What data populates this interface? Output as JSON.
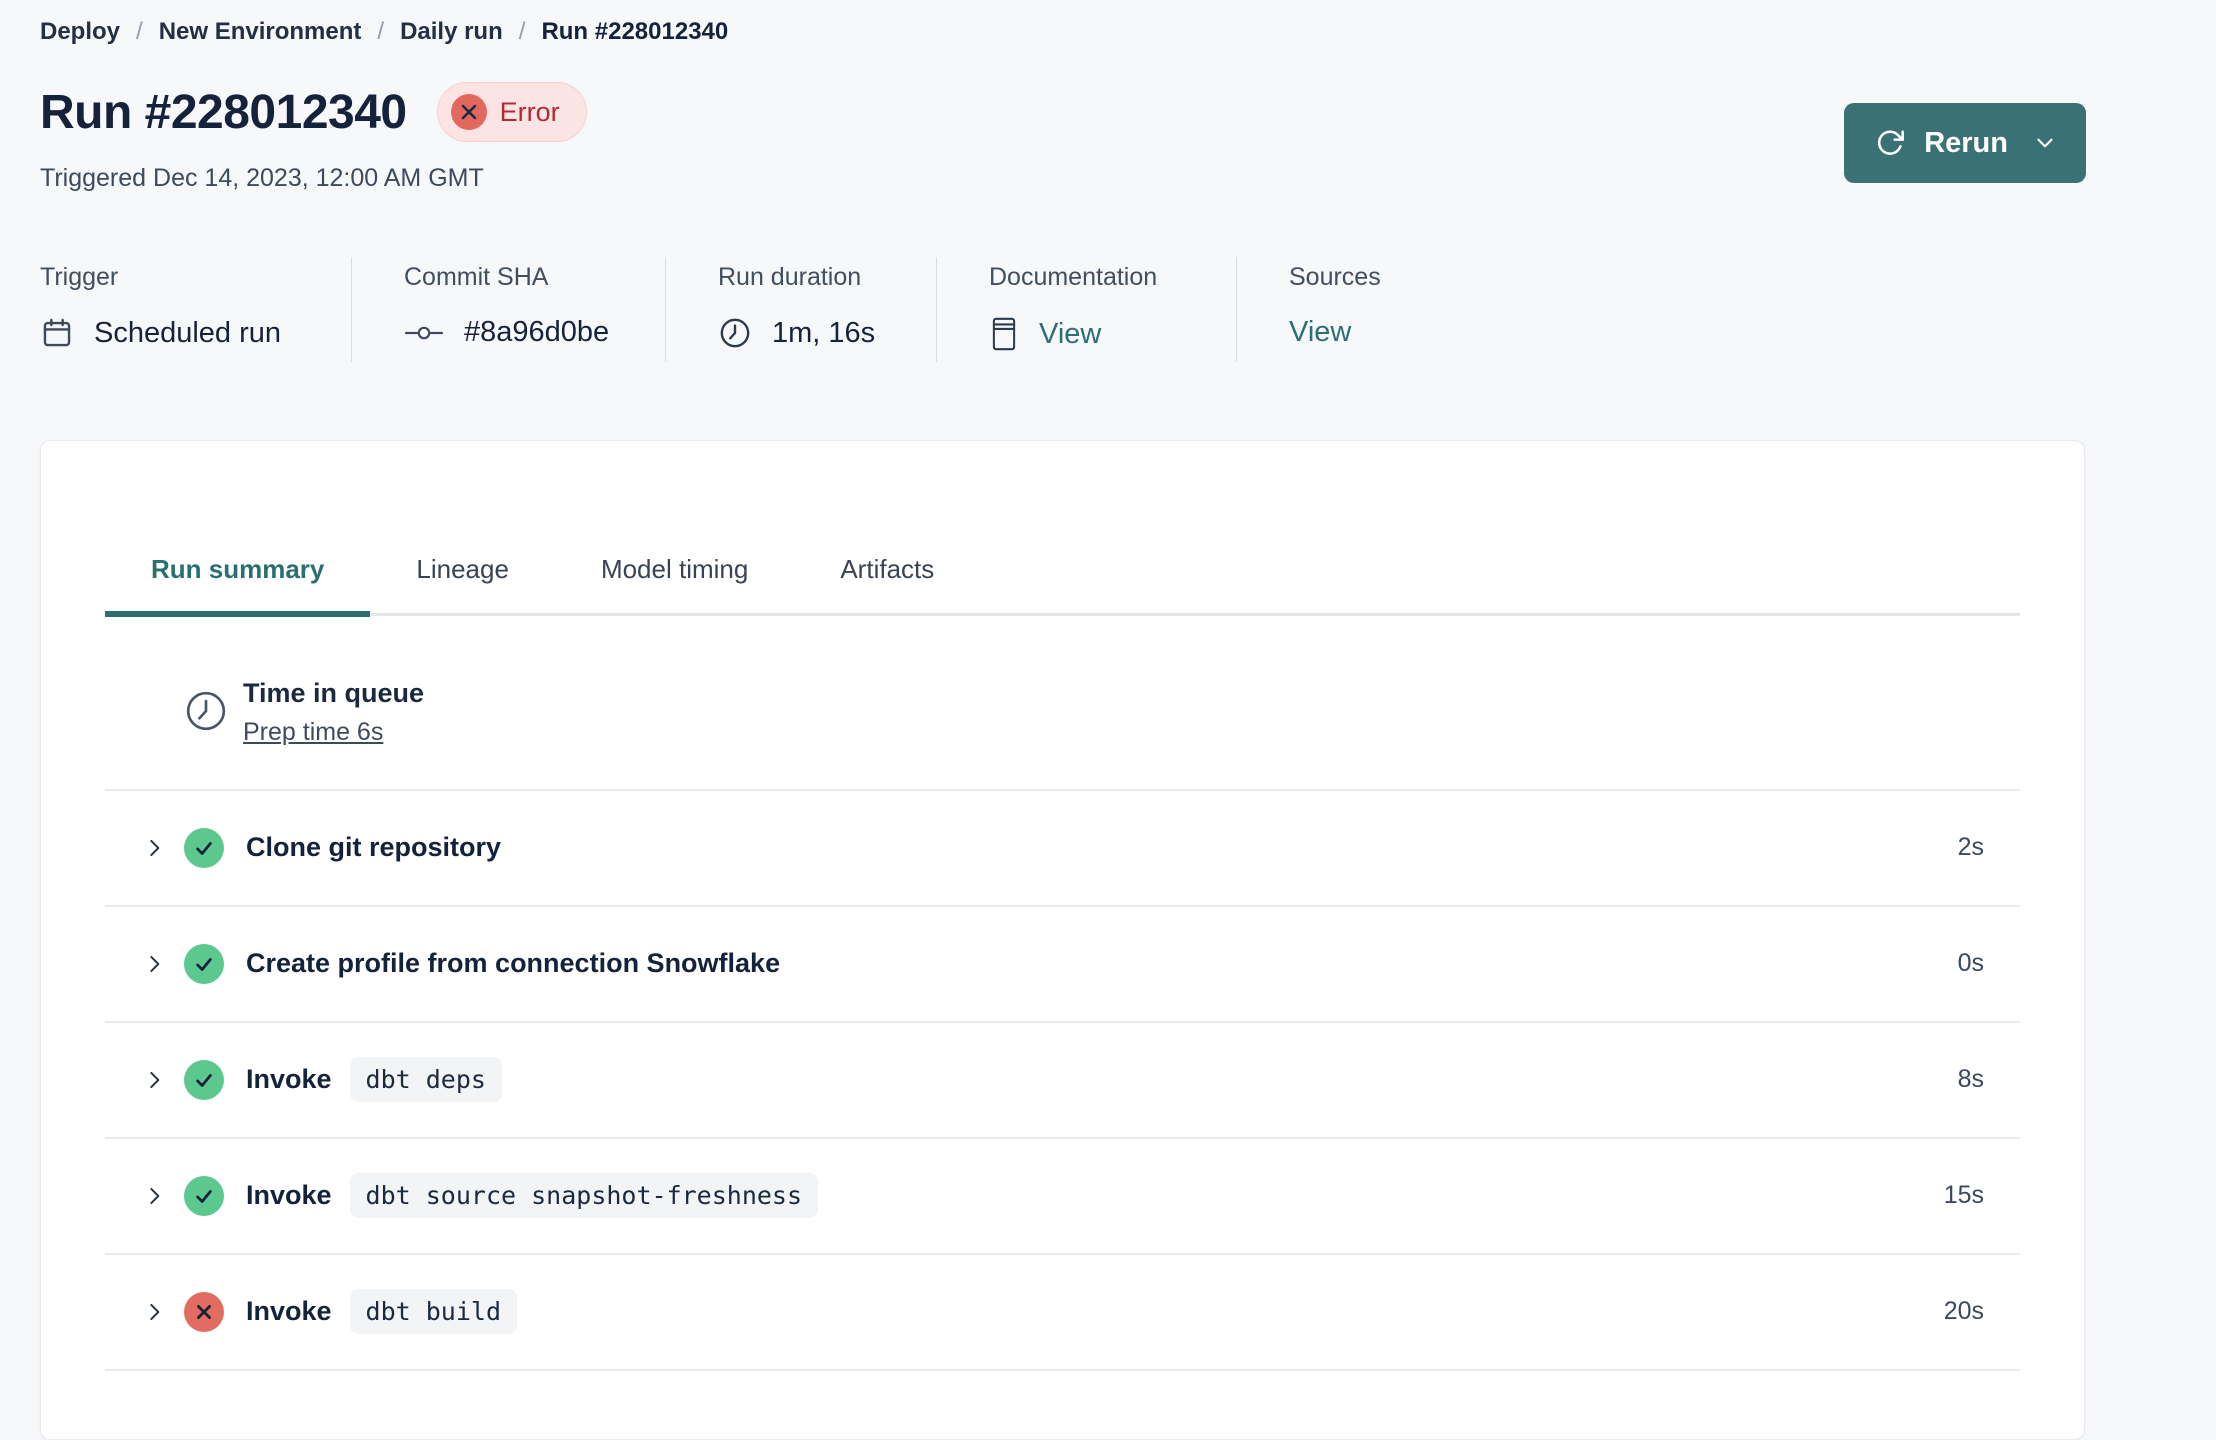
{
  "breadcrumb": {
    "separator": "/",
    "items": [
      "Deploy",
      "New Environment",
      "Daily run",
      "Run #228012340"
    ]
  },
  "header": {
    "title": "Run #228012340",
    "status_badge": {
      "label": "Error",
      "icon": "error-circle-icon"
    },
    "triggered": "Triggered Dec 14, 2023, 12:00 AM GMT",
    "rerun_button": {
      "label": "Rerun",
      "icon": "refresh-icon",
      "chevron_icon": "chevron-down-icon"
    }
  },
  "meta": {
    "columns": [
      {
        "label": "Trigger",
        "value": "Scheduled run",
        "icon": "calendar-icon",
        "link": false
      },
      {
        "label": "Commit SHA",
        "value": "#8a96d0be",
        "icon": "git-commit-icon",
        "link": false
      },
      {
        "label": "Run duration",
        "value": "1m, 16s",
        "icon": "clock-icon",
        "link": false
      },
      {
        "label": "Documentation",
        "value": "View",
        "icon": "docs-icon",
        "link": true
      },
      {
        "label": "Sources",
        "value": "View",
        "icon": null,
        "link": true
      }
    ]
  },
  "tabs": [
    {
      "label": "Run summary",
      "active": true
    },
    {
      "label": "Lineage",
      "active": false
    },
    {
      "label": "Model timing",
      "active": false
    },
    {
      "label": "Artifacts",
      "active": false
    }
  ],
  "queue": {
    "title": "Time in queue",
    "link": "Prep time 6s",
    "icon": "queue-clock-icon"
  },
  "steps": [
    {
      "label": "Clone git repository",
      "command": null,
      "status": "success",
      "duration": "2s"
    },
    {
      "label": "Create profile from connection Snowflake",
      "command": null,
      "status": "success",
      "duration": "0s"
    },
    {
      "label": "Invoke",
      "command": "dbt deps",
      "status": "success",
      "duration": "8s"
    },
    {
      "label": "Invoke",
      "command": "dbt source snapshot-freshness",
      "status": "success",
      "duration": "15s"
    },
    {
      "label": "Invoke",
      "command": "dbt build",
      "status": "error",
      "duration": "20s"
    }
  ],
  "colors": {
    "page_bg": "#f7f8fa",
    "card_bg": "#ffffff",
    "navy_text": "#15223b",
    "muted_text": "#3d4a5c",
    "teal_button": "#3a7174",
    "teal_link": "#2c6f73",
    "tab_active": "#2a6f72",
    "success_green": "#5dc88e",
    "error_red": "#e26c61",
    "badge_bg": "#fce4e4",
    "badge_text": "#b02b33",
    "chip_bg": "#f2f4f6",
    "divider": "#e8eaee"
  }
}
